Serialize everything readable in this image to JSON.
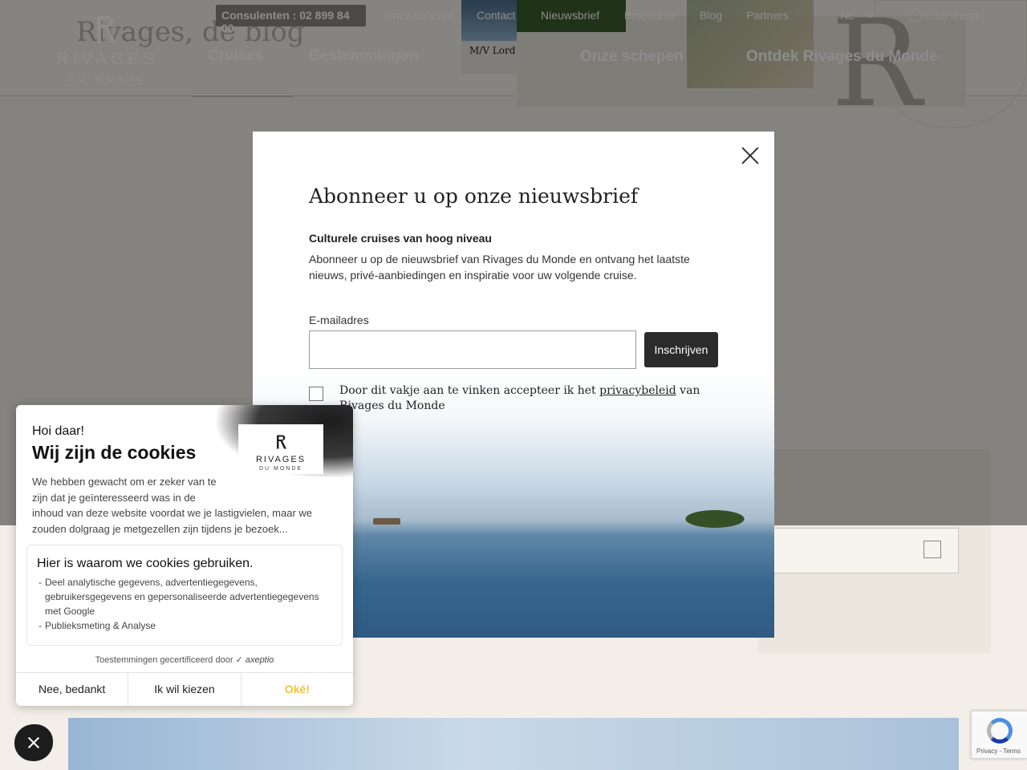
{
  "header": {
    "blog_title": "Rivages, de blog",
    "logo": {
      "word": "RIVAGES",
      "sub": "DU MONDE"
    },
    "phone_button": "Consulenten : 02 899 84 00",
    "top_links": [
      "Onze tarieven",
      "Contact",
      "Nieuwsbrief",
      "Brochures",
      "Blog",
      "Partners"
    ],
    "language": "NL",
    "club_link": "Club leden",
    "main_nav": [
      "Cruises",
      "Bestemmingen"
    ],
    "panel_links": [
      "Onze schepen",
      "Ontdek Rivages du Monde"
    ],
    "ship_thumb_label": "M/V Lord Glens"
  },
  "newsletter_modal": {
    "title": "Abonneer u op onze nieuwsbrief",
    "subtitle": "Culturele cruises van hoog niveau",
    "text": "Abonneer u op de nieuwsbrief van Rivages du Monde en ontvang het laatste nieuws, privé-aanbiedingen en inspiratie voor uw volgende cruise.",
    "email_label": "E-mailadres",
    "email_value": "",
    "email_placeholder": "",
    "subscribe_label": "Inschrijven",
    "consent_before": "Door dit vakje aan te vinken accepteer ik het ",
    "consent_link": "privacybeleid",
    "consent_after": " van Rivages du Monde"
  },
  "cookie_popup": {
    "hello": "Hoi daar!",
    "title": "Wij zijn de cookies",
    "text_lines": [
      "We hebben gewacht om er zeker van te",
      "zijn dat je geïnteresseerd was in de",
      "inhoud van deze website voordat we je lastigvielen, maar we zouden dolgraag je metgezellen zijn tijdens je bezoek..."
    ],
    "reasons_title": "Hier is waarom we cookies gebruiken.",
    "reasons": [
      "Deel analytische gegevens, advertentiegegevens, gebruikersgegevens en gepersonaliseerde advertentiegegevens met Google",
      "Publieksmeting & Analyse"
    ],
    "certified_text": "Toestemmingen gecertificeerd door",
    "certified_brand": "axeptio",
    "logo": {
      "word": "RIVAGES",
      "sub": "DU MONDE"
    },
    "buttons": {
      "decline": "Nee, bedankt",
      "choose": "Ik wil kiezen",
      "accept": "Oké!"
    }
  },
  "recaptcha": {
    "links": "Privacy - Terms"
  },
  "colors": {
    "accept": "#f2c230",
    "dark": "#2b2b2b",
    "overlay": "rgba(0,0,0,0.45)"
  }
}
